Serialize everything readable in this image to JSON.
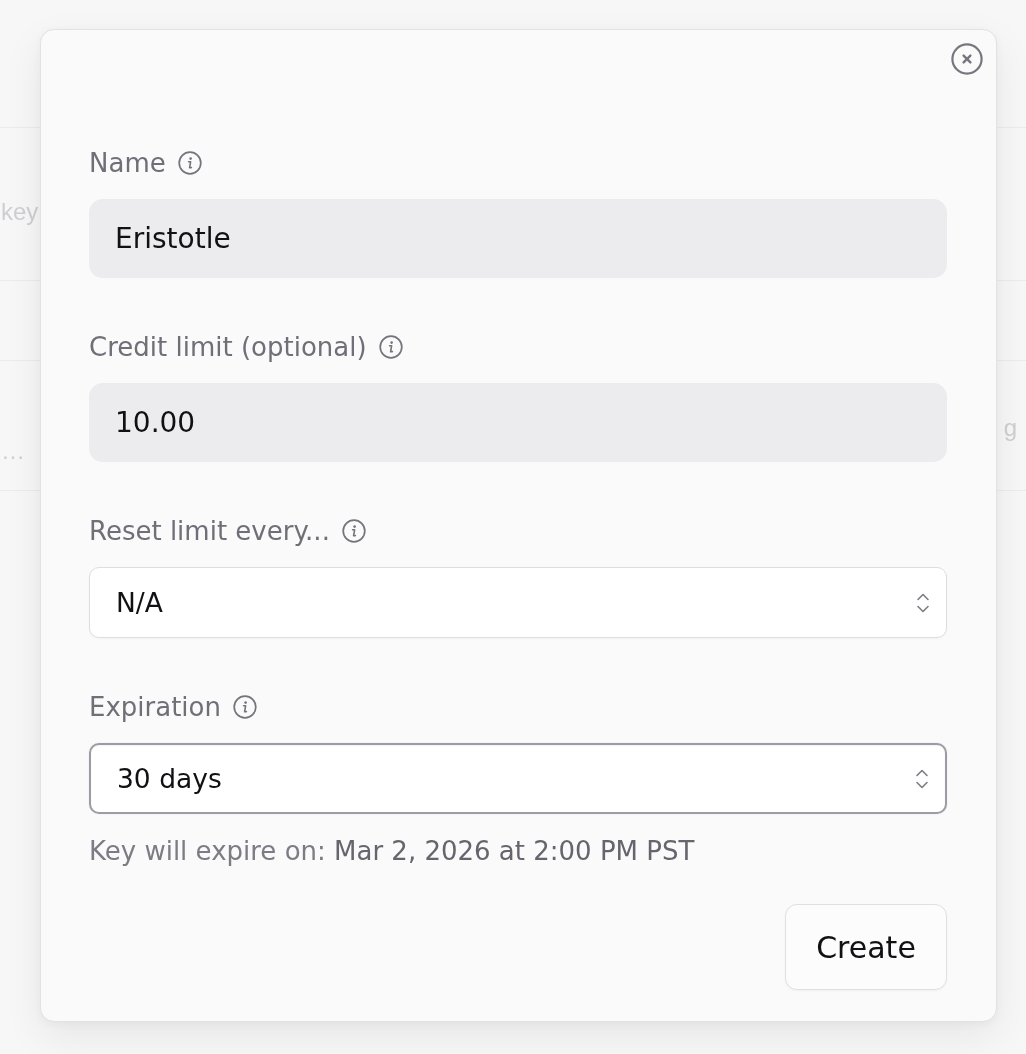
{
  "background": {
    "rows": [
      {
        "left": "key"
      },
      {
        "left": "…",
        "right": "g"
      }
    ]
  },
  "dialog": {
    "fields": [
      {
        "kind": "text",
        "label": "Name",
        "value": "Eristotle",
        "focused": false
      },
      {
        "kind": "text",
        "label": "Credit limit (optional)",
        "value": "10.00",
        "focused": false
      },
      {
        "kind": "select",
        "label": "Reset limit every...",
        "value": "N/A",
        "focused": false
      },
      {
        "kind": "select",
        "label": "Expiration",
        "value": "30 days",
        "focused": true,
        "hint": "Key will expire on: **Mar 2, 2026 at 2:00 PM PST**"
      }
    ],
    "buttons": [
      {
        "label": "Create"
      }
    ]
  }
}
